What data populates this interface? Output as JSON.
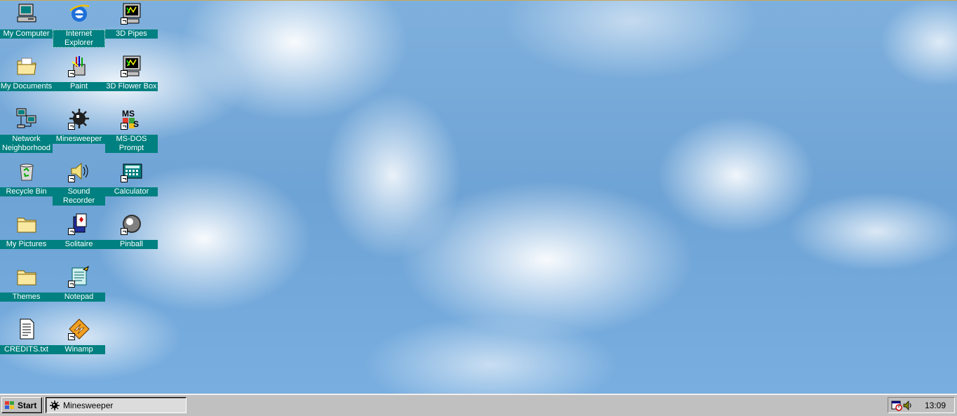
{
  "desktop": {
    "icons": [
      {
        "id": "my-computer",
        "label": "My Computer",
        "icon": "computer-icon",
        "shortcut": false
      },
      {
        "id": "internet-explorer",
        "label": "Internet Explorer",
        "icon": "internet-explorer-icon",
        "shortcut": false,
        "selected": true
      },
      {
        "id": "3d-pipes",
        "label": "3D Pipes",
        "icon": "screensaver-icon",
        "shortcut": true
      },
      {
        "id": "my-documents",
        "label": "My Documents",
        "icon": "folder-documents-icon",
        "shortcut": false
      },
      {
        "id": "paint",
        "label": "Paint",
        "icon": "paint-icon",
        "shortcut": true
      },
      {
        "id": "3d-flower-box",
        "label": "3D Flower Box",
        "icon": "screensaver-icon",
        "shortcut": true
      },
      {
        "id": "network-neighborhood",
        "label": "Network Neighborhood",
        "icon": "network-icon",
        "shortcut": false
      },
      {
        "id": "minesweeper",
        "label": "Minesweeper",
        "icon": "mine-icon",
        "shortcut": true
      },
      {
        "id": "ms-dos-prompt",
        "label": "MS-DOS Prompt",
        "icon": "msdos-icon",
        "shortcut": true
      },
      {
        "id": "recycle-bin",
        "label": "Recycle Bin",
        "icon": "recycle-bin-icon",
        "shortcut": false
      },
      {
        "id": "sound-recorder",
        "label": "Sound Recorder",
        "icon": "speaker-icon",
        "shortcut": true
      },
      {
        "id": "calculator",
        "label": "Calculator",
        "icon": "calculator-icon",
        "shortcut": true
      },
      {
        "id": "my-pictures",
        "label": "My Pictures",
        "icon": "folder-icon",
        "shortcut": false
      },
      {
        "id": "solitaire",
        "label": "Solitaire",
        "icon": "cards-icon",
        "shortcut": true
      },
      {
        "id": "pinball",
        "label": "Pinball",
        "icon": "pinball-icon",
        "shortcut": true
      },
      {
        "id": "themes",
        "label": "Themes",
        "icon": "folder-icon",
        "shortcut": false
      },
      {
        "id": "notepad",
        "label": "Notepad",
        "icon": "notepad-icon",
        "shortcut": true
      },
      {
        "id": "credits",
        "label": "CREDITS.txt",
        "icon": "text-file-icon",
        "shortcut": false
      },
      {
        "id": "winamp",
        "label": "Winamp",
        "icon": "winamp-icon",
        "shortcut": true
      }
    ]
  },
  "taskbar": {
    "start_label": "Start",
    "tasks": [
      {
        "label": "Minesweeper",
        "icon": "mine-icon",
        "active": true
      }
    ],
    "tray": {
      "icons": [
        "scheduler-icon",
        "volume-icon"
      ],
      "clock": "13:09"
    }
  },
  "colors": {
    "label_bg": "#008080",
    "taskbar": "#c0c0c0"
  }
}
